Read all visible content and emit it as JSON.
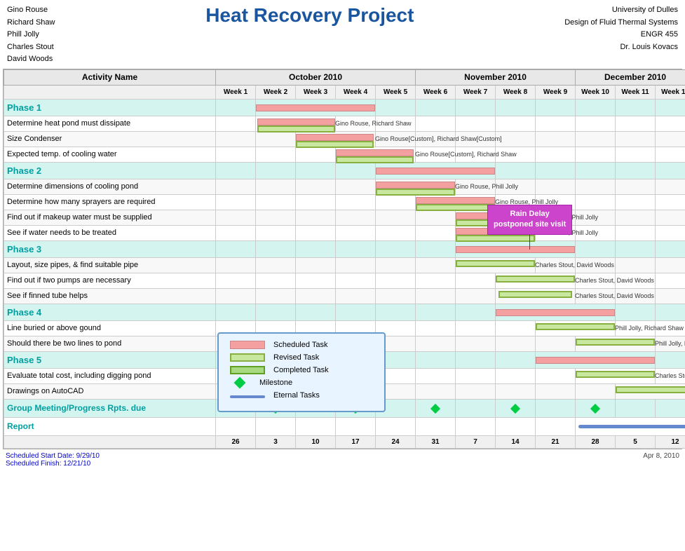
{
  "header": {
    "team": [
      "Gino Rouse",
      "Richard Shaw",
      "Phill Jolly",
      "Charles Stout",
      "David Woods"
    ],
    "title": "Heat Recovery Project",
    "university": "University of Dulles",
    "course1": "Design of Fluid Thermal Systems",
    "course2": "ENGR 455",
    "instructor": "Dr. Louis Kovacs"
  },
  "months": [
    "October  2010",
    "November  2010",
    "December  2010"
  ],
  "weeks": [
    "Week 1",
    "Week 2",
    "Week 3",
    "Week 4",
    "Week 5",
    "Week 6",
    "Week 7",
    "Week 8",
    "Week 9",
    "Week 10",
    "Week 11",
    "Week 12"
  ],
  "week_numbers": [
    "26",
    "3",
    "10",
    "17",
    "24",
    "31",
    "7",
    "14",
    "21",
    "28",
    "5",
    "12"
  ],
  "activity_col_label": "Activity Name",
  "phases": [
    {
      "name": "Phase 1",
      "tasks": [
        "Determine heat pond must dissipate",
        "Size Condenser",
        "Expected temp. of cooling water"
      ]
    },
    {
      "name": "Phase 2",
      "tasks": [
        "Determine dimensions of cooling pond",
        "Determine how many sprayers are required",
        "Find out if makeup water must be supplied",
        "See if water needs to be treated"
      ]
    },
    {
      "name": "Phase 3",
      "tasks": [
        "Layout, size pipes, & find suitable pipe",
        "Find out if two pumps are necessary",
        "See if finned tube helps"
      ]
    },
    {
      "name": "Phase 4",
      "tasks": [
        "Line buried or above gound",
        "Should there be two lines to pond"
      ]
    },
    {
      "name": "Phase 5",
      "tasks": [
        "Evaluate total cost, including digging pond",
        "Drawings on AutoCAD"
      ]
    }
  ],
  "bottom_rows": [
    "Group Meeting/Progress Rpts. due",
    "Report"
  ],
  "legend": {
    "scheduled": "Scheduled Task",
    "revised": "Revised Task",
    "completed": "Completed Task",
    "milestone": "Milestone",
    "eternal": "Eternal Tasks"
  },
  "callout": {
    "text": "Rain Delay\npostponed site visit"
  },
  "footer": {
    "start_label": "Scheduled Start Date: 9/29/10",
    "finish_label": "Scheduled Finish: 12/21/10",
    "date": "Apr 8, 2010"
  }
}
